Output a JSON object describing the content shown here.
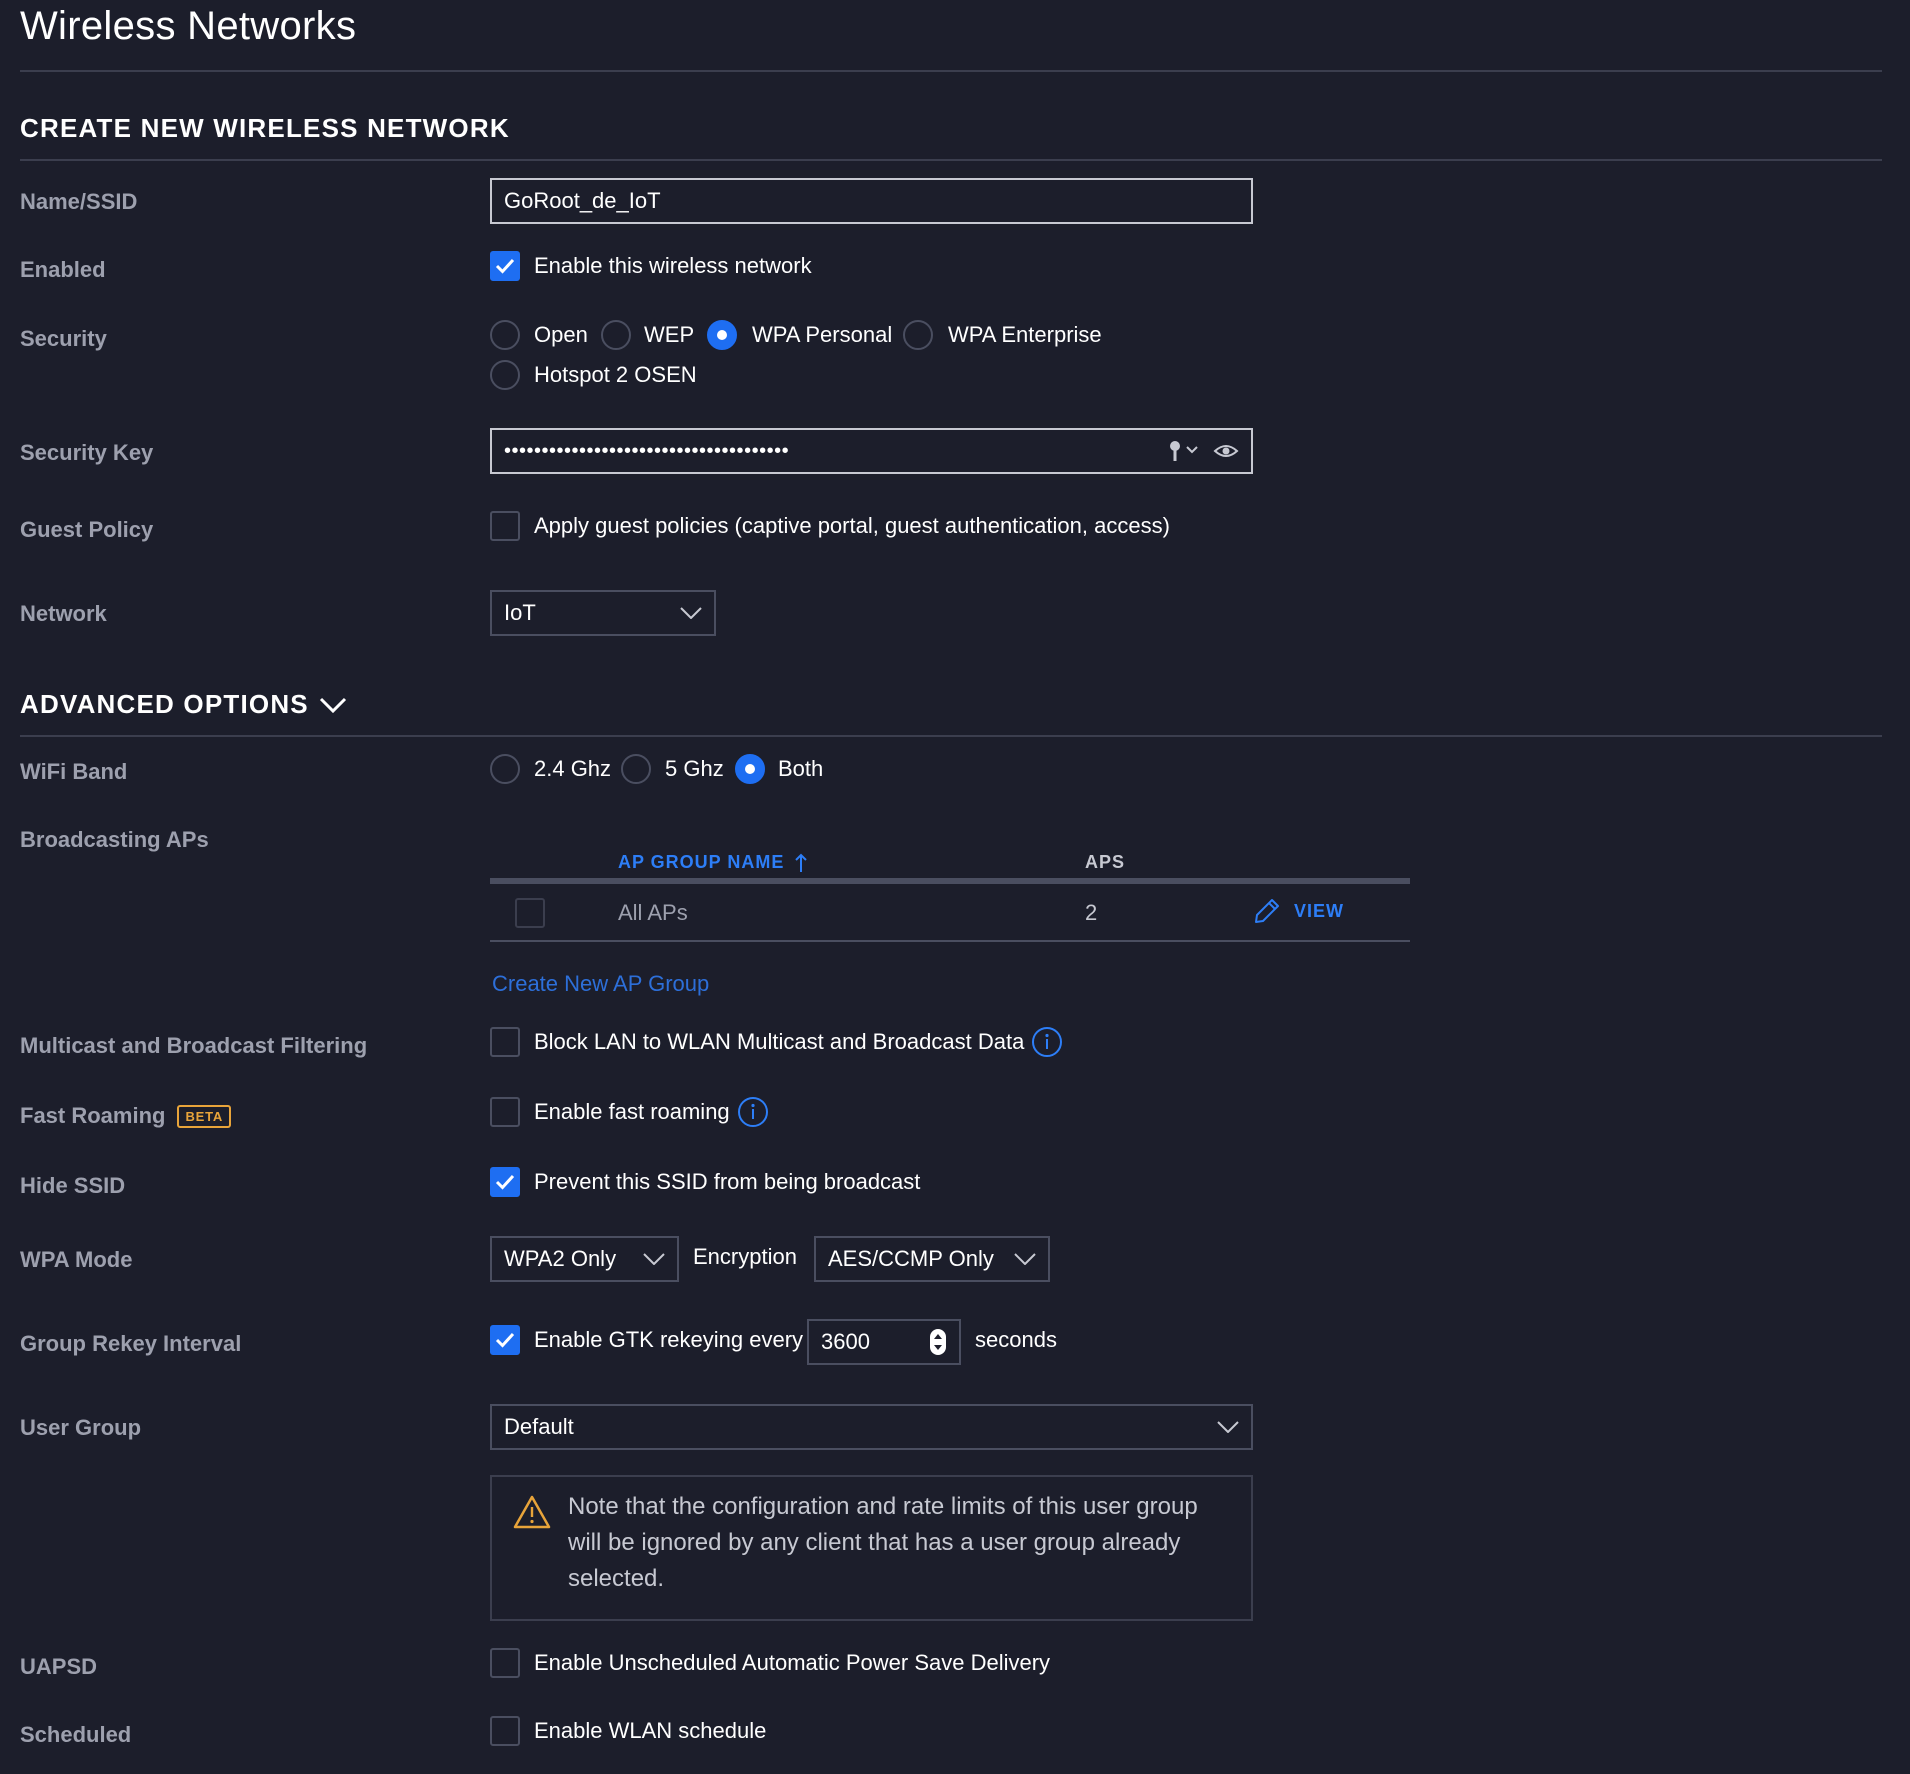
{
  "page": {
    "title": "Wireless Networks"
  },
  "create": {
    "heading": "CREATE NEW WIRELESS NETWORK",
    "name_label": "Name/SSID",
    "name_value": "GoRoot_de_IoT",
    "enabled_label": "Enabled",
    "enabled_text": "Enable this wireless network",
    "enabled_checked": true,
    "security_label": "Security",
    "security_options": [
      "Open",
      "WEP",
      "WPA Personal",
      "WPA Enterprise",
      "Hotspot 2 OSEN"
    ],
    "security_selected": "WPA Personal",
    "security_key_label": "Security Key",
    "security_key_value": "••••••••••••••••••••••••••••••••••••••",
    "guest_label": "Guest Policy",
    "guest_text": "Apply guest policies (captive portal, guest authentication, access)",
    "guest_checked": false,
    "network_label": "Network",
    "network_value": "IoT"
  },
  "advanced": {
    "heading": "ADVANCED OPTIONS",
    "wifi_band_label": "WiFi Band",
    "bands": [
      "2.4 Ghz",
      "5 Ghz",
      "Both"
    ],
    "band_selected": "Both",
    "broadcasting_label": "Broadcasting APs",
    "table": {
      "col_group": "AP GROUP NAME",
      "col_aps": "APS",
      "rows": [
        {
          "name": "All APs",
          "aps": "2",
          "action": "VIEW"
        }
      ]
    },
    "create_group_link": "Create New AP Group",
    "multicast_label": "Multicast and Broadcast Filtering",
    "multicast_text": "Block LAN to WLAN Multicast and Broadcast Data",
    "fast_roaming_label": "Fast Roaming",
    "beta_badge": "BETA",
    "fast_roaming_text": "Enable fast roaming",
    "hide_ssid_label": "Hide SSID",
    "hide_ssid_text": "Prevent this SSID from being broadcast",
    "wpa_mode_label": "WPA Mode",
    "wpa_mode_value": "WPA2 Only",
    "encryption_label": "Encryption",
    "encryption_value": "AES/CCMP Only",
    "rekey_label": "Group Rekey Interval",
    "rekey_text": "Enable GTK rekeying every",
    "rekey_value": "3600",
    "rekey_unit": "seconds",
    "user_group_label": "User Group",
    "user_group_value": "Default",
    "note_lines": [
      "Note that the configuration and rate limits of this user group",
      "will be ignored by any client that has a user group already",
      "selected."
    ],
    "uapsd_label": "UAPSD",
    "uapsd_text": "Enable Unscheduled Automatic Power Save Delivery",
    "scheduled_label": "Scheduled",
    "scheduled_text": "Enable WLAN schedule"
  },
  "colors": {
    "accent": "#1e6ef2",
    "link": "#2d7ef7",
    "warning": "#e8a43a",
    "background": "#1c1e2b"
  }
}
